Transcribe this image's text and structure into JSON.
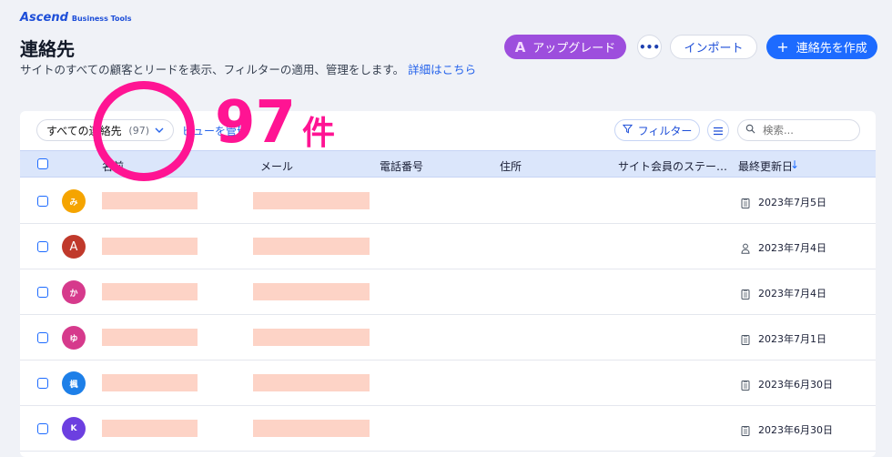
{
  "brand": {
    "name": "Ascend",
    "sub": "Business Tools"
  },
  "page": {
    "title": "連絡先",
    "subtitle": "サイトのすべての顧客とリードを表示、フィルターの適用、管理をします。",
    "details_link": "詳細はこちら"
  },
  "header_buttons": {
    "upgrade_icon": "A",
    "upgrade": "アップグレード",
    "more": "•••",
    "import": "インポート",
    "create_icon": "+",
    "create": "連絡先を作成"
  },
  "toolbar": {
    "view_select": "すべての連絡先",
    "view_count": "(97)",
    "manage_views": "ビューを管理",
    "filter": "フィルター",
    "search_placeholder": "検索..."
  },
  "table": {
    "columns": [
      "名前",
      "メール",
      "電話番号",
      "住所",
      "サイト会員のステー…",
      "最終更新日"
    ],
    "sort_indicator": "↓",
    "rows": [
      {
        "avatar": "み",
        "avatar_color": "#f5a400",
        "date_icon": "clipboard-icon",
        "date": "2023年7月5日"
      },
      {
        "avatar": "A",
        "avatar_color": "#c0392b",
        "date_icon": "person-icon",
        "date": "2023年7月4日"
      },
      {
        "avatar": "か",
        "avatar_color": "#d63a8c",
        "date_icon": "clipboard-icon",
        "date": "2023年7月4日"
      },
      {
        "avatar": "ゆ",
        "avatar_color": "#d63a8c",
        "date_icon": "clipboard-icon",
        "date": "2023年7月1日"
      },
      {
        "avatar": "楓",
        "avatar_color": "#1d7fe8",
        "date_icon": "clipboard-icon",
        "date": "2023年6月30日"
      },
      {
        "avatar": "K",
        "avatar_color": "#6c3fe0",
        "date_icon": "clipboard-icon",
        "date": "2023年6月30日"
      }
    ]
  },
  "annotation": {
    "count": "97",
    "unit": "件",
    "color": "#ff1493"
  }
}
